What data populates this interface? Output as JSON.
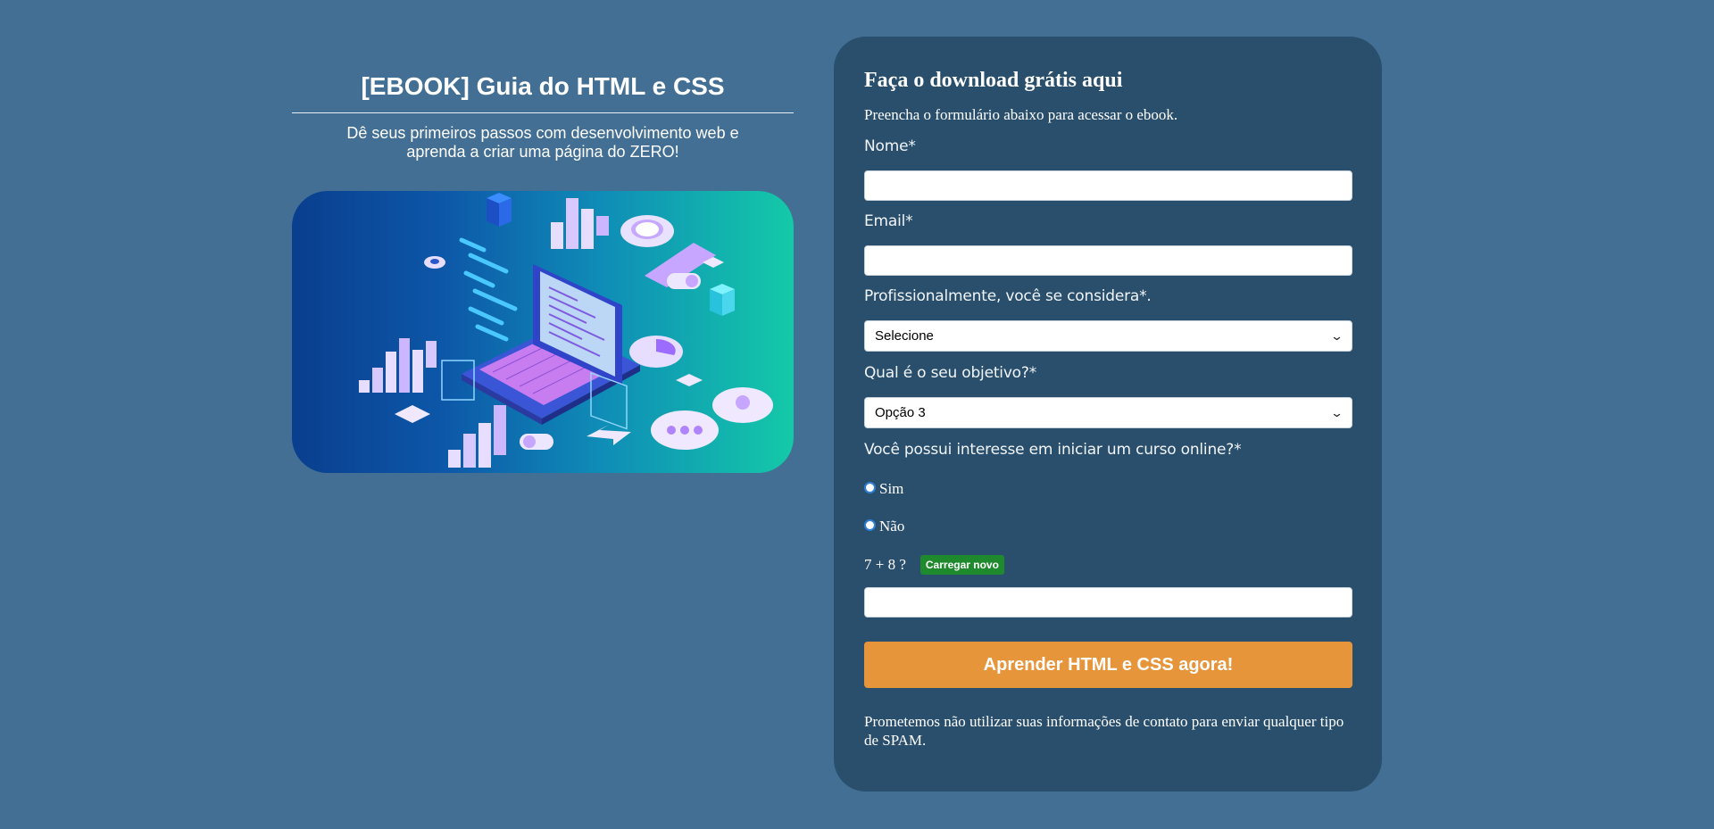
{
  "ebook": {
    "title": "[EBOOK] Guia do HTML e CSS",
    "subtitle": "Dê seus primeiros passos com desenvolvimento web e aprenda a criar uma página do ZERO!",
    "hero_image": "isometric laptop with code, charts and web icons illustration"
  },
  "form": {
    "heading": "Faça o download grátis aqui",
    "intro": "Preencha o formulário abaixo para acessar o ebook.",
    "name_label": "Nome*",
    "name_value": "",
    "email_label": "Email*",
    "email_value": "",
    "profession_label": "Profissionalmente, você se considera*.",
    "profession_selected": "Selecione",
    "objective_label": "Qual é o seu objetivo?*",
    "objective_selected": "Opção 3",
    "course_label": "Você possui interesse em iniciar um curso online?*",
    "course_options": [
      "Sim",
      "Não"
    ],
    "captcha_question": "7 + 8 ?",
    "captcha_reload": "Carregar novo",
    "captcha_value": "",
    "submit_label": "Aprender HTML e CSS agora!",
    "disclaimer": "Prometemos não utilizar suas informações de contato para enviar qualquer tipo de SPAM."
  },
  "colors": {
    "background": "#426f93",
    "panel": "#294f6c",
    "submit": "#e6953a",
    "reload": "#1f8a2d"
  }
}
